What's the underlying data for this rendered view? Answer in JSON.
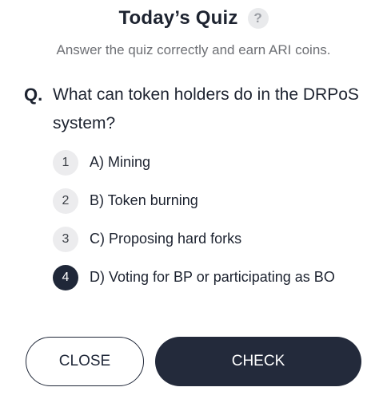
{
  "header": {
    "title": "Today’s Quiz",
    "help_icon": "?",
    "subtitle": "Answer the quiz correctly and earn ARI coins."
  },
  "question": {
    "marker": "Q.",
    "text": "What can token holders do in the DRPoS system?"
  },
  "options": [
    {
      "number": "1",
      "label": "A) Mining",
      "selected": false
    },
    {
      "number": "2",
      "label": "B) Token burning",
      "selected": false
    },
    {
      "number": "3",
      "label": "C) Proposing hard forks",
      "selected": false
    },
    {
      "number": "4",
      "label": "D) Voting for BP or participating as BO",
      "selected": true
    }
  ],
  "buttons": {
    "close_label": "CLOSE",
    "check_label": "CHECK"
  },
  "colors": {
    "primary_dark": "#232a3b",
    "option_bg": "#ececee",
    "subtitle": "#6e7075"
  }
}
